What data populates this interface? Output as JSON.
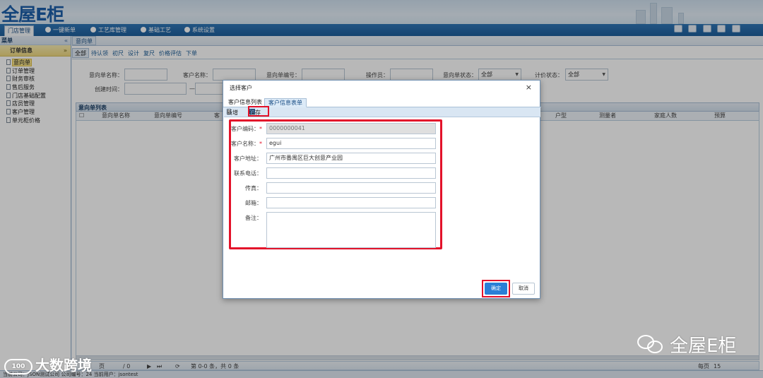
{
  "app": {
    "logo": "全屋E柜"
  },
  "topnav": {
    "tabs": [
      {
        "label": "门店管理",
        "active": true
      },
      {
        "label": "一键新单"
      },
      {
        "label": "工艺库管理"
      },
      {
        "label": "基础工艺"
      },
      {
        "label": "系统设置"
      }
    ],
    "tool_icons": [
      "camera-icon",
      "document-icon",
      "user-icon",
      "gear-icon",
      "window-icon"
    ]
  },
  "sidebar": {
    "title": "菜单",
    "group": "订单信息",
    "items": [
      {
        "label": "意向单",
        "active": true
      },
      {
        "label": "订单管理"
      },
      {
        "label": "财务审核"
      },
      {
        "label": "售后服务"
      },
      {
        "label": "门店基础配置"
      },
      {
        "label": "店员管理"
      },
      {
        "label": "客户管理"
      },
      {
        "label": "单元柜价格"
      }
    ]
  },
  "main": {
    "tab": "意向单",
    "filter_tabs": [
      "全部",
      "待认领",
      "初尺",
      "设计",
      "复尺",
      "价格评估",
      "下单"
    ],
    "search": {
      "intent_name_label": "意向单名称：",
      "customer_name_label": "客户名称：",
      "intent_no_label": "意向单编号：",
      "operator_label": "操作员：",
      "intent_status_label": "意向单状态：",
      "intent_status_value": "全部",
      "price_status_label": "计价状态：",
      "price_status_value": "全部",
      "created_label": "创建时间：",
      "date_sep": "—"
    },
    "list_title": "意向单列表",
    "columns": [
      "意向单名称",
      "意向单编号",
      "客",
      "户型",
      "测量者",
      "家庭人数",
      "预算"
    ],
    "pager": {
      "page_label": "页",
      "page_of": "/ 0",
      "summary": "第 0-0 条，共 0 条",
      "per_page_label": "每页",
      "per_page_value": "15"
    }
  },
  "statusbar": {
    "text": "当前公司：JSON测试公司    公司编号：24    当前用户：jsontest"
  },
  "dialog": {
    "title": "选择客户",
    "close": "×",
    "tabs": [
      {
        "label": "客户信息列表"
      },
      {
        "label": "客户信息表单",
        "active": true
      }
    ],
    "toolbar": {
      "new_label": "新增",
      "save_label": "保存"
    },
    "fields": {
      "code_label": "客户编码：",
      "code_required": "*",
      "code_value": "0000000041",
      "name_label": "客户名称：",
      "name_required": "*",
      "name_value": "egui",
      "address_label": "客户地址：",
      "address_value": "广州市番禺区巨大创意产业园",
      "phone_label": "联系电话：",
      "phone_value": "",
      "fax_label": "传真：",
      "fax_value": "",
      "email_label": "邮箱：",
      "email_value": "",
      "remark_label": "备注：",
      "remark_value": ""
    },
    "ok_label": "确定",
    "cancel_label": "取消"
  },
  "watermarks": {
    "left_badge": "100",
    "left_text": "大数跨境",
    "right_text": "全屋E柜"
  },
  "colors": {
    "highlight_red": "#e3122a",
    "primary_blue": "#2a7fd6",
    "nav_blue": "#1f5f9c"
  }
}
